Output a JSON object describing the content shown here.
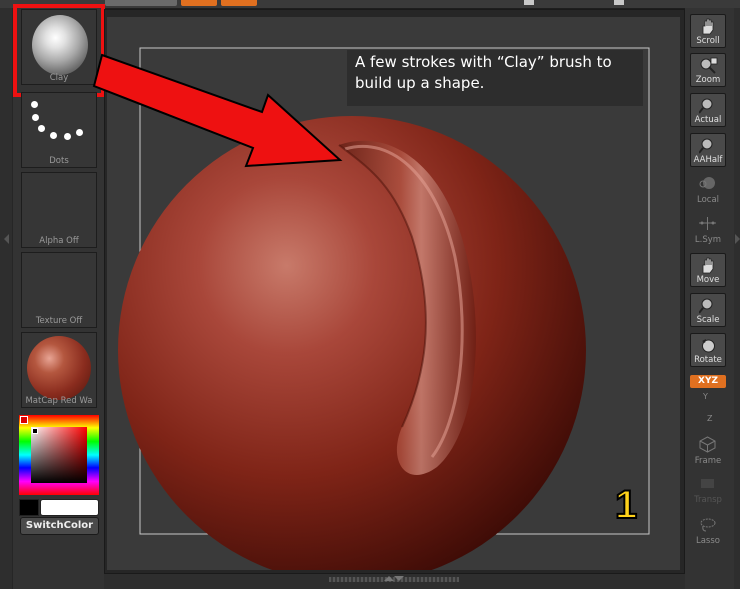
{
  "left_panel": {
    "brush": {
      "label": "Clay"
    },
    "stroke": {
      "label": "Dots"
    },
    "alpha": {
      "label": "Alpha Off"
    },
    "texture": {
      "label": "Texture Off"
    },
    "material": {
      "label": "MatCap Red Wa"
    },
    "switch_color": {
      "label": "SwitchColor"
    }
  },
  "right_panel": {
    "buttons": [
      {
        "label": "Scroll",
        "icon": "hand-icon",
        "enabled": true
      },
      {
        "label": "Zoom",
        "icon": "zoom-icon",
        "enabled": true
      },
      {
        "label": "Actual",
        "icon": "magnifier-icon",
        "enabled": true
      },
      {
        "label": "AAHalf",
        "icon": "magnifier-icon",
        "enabled": true
      },
      {
        "label": "Local",
        "icon": "sphere-icon",
        "enabled": false
      },
      {
        "label": "L.Sym",
        "icon": "symmetry-icon",
        "enabled": false
      },
      {
        "label": "Move",
        "icon": "hand-icon",
        "enabled": true
      },
      {
        "label": "Scale",
        "icon": "magnifier-icon",
        "enabled": true
      },
      {
        "label": "Rotate",
        "icon": "rotate-icon",
        "enabled": true
      },
      {
        "label": "Frame",
        "icon": "cube-icon",
        "enabled": false
      },
      {
        "label": "Transp",
        "icon": "transparency-icon",
        "enabled": false
      },
      {
        "label": "Lasso",
        "icon": "lasso-icon",
        "enabled": false
      }
    ],
    "xyz_label": "XYZ",
    "y_label": "Y",
    "z_label": "Z"
  },
  "annotation": {
    "caption": "A few strokes with “Clay” brush to build up a shape.",
    "step_number": "1"
  },
  "colors": {
    "accent": "#e07020",
    "highlight": "#ee1111",
    "sculpt": "#8a2c1e",
    "step_number": "#ffd21a"
  }
}
